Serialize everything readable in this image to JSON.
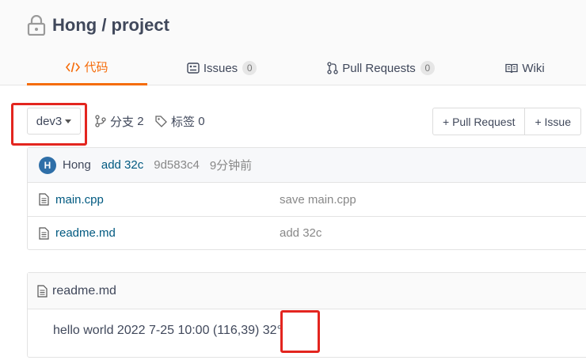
{
  "repo": {
    "owner": "Hong",
    "separator": " / ",
    "name": "project"
  },
  "tabs": [
    {
      "label": "代码",
      "icon": "code-icon",
      "active": true
    },
    {
      "label": "Issues",
      "icon": "issues-icon",
      "count": "0"
    },
    {
      "label": "Pull Requests",
      "icon": "pull-request-icon",
      "count": "0"
    },
    {
      "label": "Wiki",
      "icon": "wiki-icon"
    }
  ],
  "toolbar": {
    "branch": "dev3",
    "branches_label": "分支",
    "branches_count": "2",
    "tags_label": "标签",
    "tags_count": "0",
    "new_pull_request": "+ Pull Request",
    "new_issue": "+ Issue"
  },
  "commit": {
    "avatar_initial": "H",
    "author": "Hong",
    "message": "add 32c",
    "sha": "9d583c4",
    "time": "9分钟前"
  },
  "files": [
    {
      "name": "main.cpp",
      "commit_message": "save main.cpp"
    },
    {
      "name": "readme.md",
      "commit_message": "add 32c"
    }
  ],
  "readme": {
    "filename": "readme.md",
    "content_main": "hello world 2022 7-25 10:00 (116,39) ",
    "content_highlight": "32°"
  },
  "colors": {
    "accent": "#f56c0a",
    "highlight": "#e3251f",
    "link": "#005980"
  }
}
